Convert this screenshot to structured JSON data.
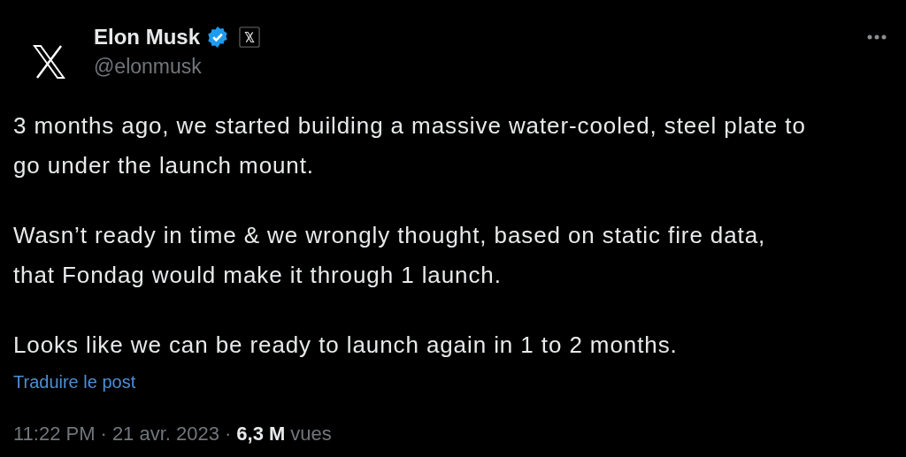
{
  "author": {
    "name": "Elon Musk",
    "verified": true,
    "affiliate_badge": true,
    "handle": "@elonmusk"
  },
  "paragraphs": [
    {
      "lines": [
        "3 months ago, we started building a massive water-cooled, steel plate to",
        "go under the launch mount."
      ]
    },
    {
      "lines": [
        "Wasn’t ready in time & we wrongly thought, based on static fire data,",
        "that Fondag would make it through 1 launch."
      ]
    },
    {
      "lines": [
        "Looks like we can be ready to launch again in 1 to 2 months."
      ]
    }
  ],
  "translate_link": "Traduire le post",
  "meta": {
    "time": "11:22 PM",
    "separator": "·",
    "date": "21 avr. 2023",
    "views_count": "6,3 M",
    "views_label": "vues"
  }
}
